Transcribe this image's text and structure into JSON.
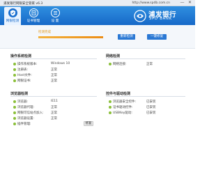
{
  "window": {
    "title": "浦发银行网银安全管家 v6.3",
    "url": "http://www.spdb.com.cn",
    "minimize": "—",
    "close": "✕"
  },
  "tabs": [
    {
      "label": "网银检测",
      "icon": "shield-check-icon",
      "active": true
    },
    {
      "label": "证书管理",
      "icon": "certificate-icon",
      "active": false
    },
    {
      "label": "设 置",
      "icon": "menu-lines-icon",
      "active": false
    }
  ],
  "brand": {
    "name_cn": "浦发银行",
    "name_en": "SPD BANK",
    "icon": "spd-bank-logo"
  },
  "scan": {
    "status": "检测完成",
    "progress": 1.0
  },
  "actions": {
    "rescan": "重新检测",
    "one_click_fix": "一键修复"
  },
  "sections": {
    "os": {
      "title": "操作系统检测",
      "rows": [
        {
          "label": "操作系统版本:",
          "value": "Windows 10"
        },
        {
          "label": "注册表:",
          "value": "正常"
        },
        {
          "label": "Host文件:",
          "value": "正常"
        },
        {
          "label": "网银证书:",
          "value": "正常"
        }
      ]
    },
    "network": {
      "title": "网络检测",
      "rows": [
        {
          "label": "网络连接:",
          "value": "正常"
        }
      ]
    },
    "browser": {
      "title": "浏览器检测",
      "fix_label": "修复",
      "rows": [
        {
          "label": "浏览器:",
          "value": "IE11"
        },
        {
          "label": "浏览器代理:",
          "value": "正常"
        },
        {
          "label": "网银可信站点加入:",
          "value": "正常"
        },
        {
          "label": "浏览器设置:",
          "value": "正常"
        },
        {
          "label": "插件管理:",
          "value": ""
        }
      ]
    },
    "controls": {
      "title": "控件与驱动检测",
      "rows": [
        {
          "label": "浏览器安全控件:",
          "value": "已安装"
        },
        {
          "label": "证书驱动控件:",
          "value": "已安装"
        },
        {
          "label": "USBKey驱动:",
          "value": "已安装"
        }
      ]
    }
  },
  "colors": {
    "header_top": "#2f8fe0",
    "header_bottom": "#1769c8",
    "status_ok": "#8bbf3a",
    "progress": "#ec8d16",
    "button": "#2a78d4"
  }
}
